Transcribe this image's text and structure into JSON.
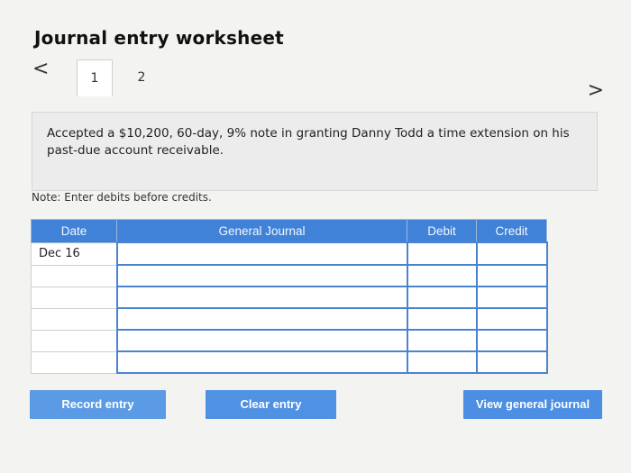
{
  "title": "Journal entry worksheet",
  "nav": {
    "prev_symbol": "<",
    "next_symbol": ">",
    "steps": [
      "1",
      "2"
    ]
  },
  "question": "Accepted a $10,200, 60-day, 9% note in granting Danny Todd a time extension on his past-due account receivable.",
  "note": "Note: Enter debits before credits.",
  "table": {
    "headers": {
      "date": "Date",
      "general_journal": "General Journal",
      "debit": "Debit",
      "credit": "Credit"
    },
    "rows": [
      {
        "date": "Dec 16",
        "account": "",
        "debit": "",
        "credit": ""
      },
      {
        "date": "",
        "account": "",
        "debit": "",
        "credit": ""
      },
      {
        "date": "",
        "account": "",
        "debit": "",
        "credit": ""
      },
      {
        "date": "",
        "account": "",
        "debit": "",
        "credit": ""
      },
      {
        "date": "",
        "account": "",
        "debit": "",
        "credit": ""
      },
      {
        "date": "",
        "account": "",
        "debit": "",
        "credit": ""
      }
    ]
  },
  "buttons": {
    "record": "Record entry",
    "clear": "Clear entry",
    "view": "View general journal"
  },
  "colors": {
    "header_blue": "#3f82d8",
    "button_blue": "#5b9be6",
    "input_border": "#4a84cf"
  }
}
